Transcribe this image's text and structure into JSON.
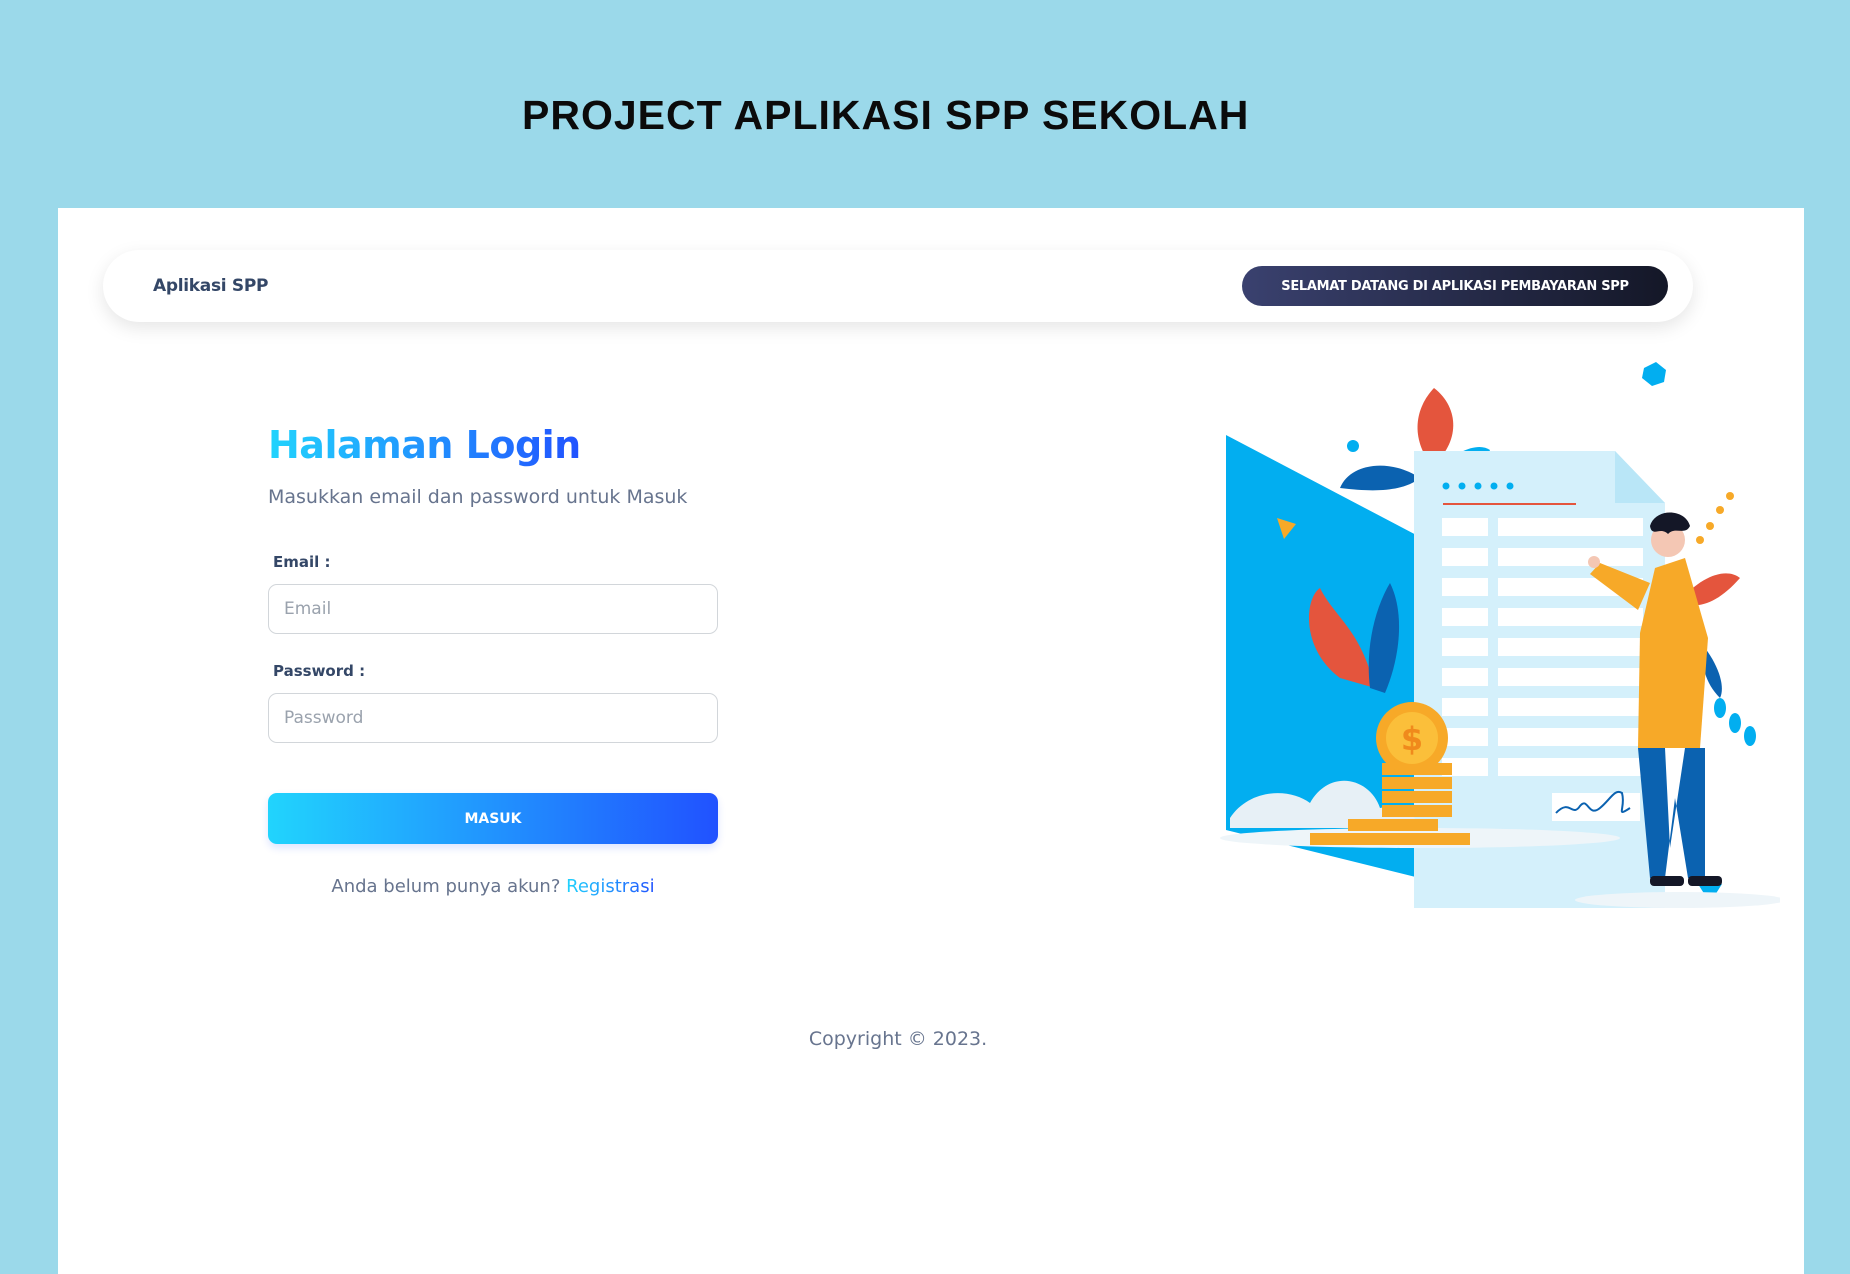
{
  "banner": {
    "title": "PROJECT APLIKASI SPP SEKOLAH"
  },
  "navbar": {
    "brand": "Aplikasi SPP",
    "welcome": "SELAMAT DATANG DI APLIKASI PEMBAYARAN SPP"
  },
  "login": {
    "title": "Halaman Login",
    "subtitle": "Masukkan email dan password untuk Masuk",
    "email_label": "Email :",
    "email_placeholder": "Email",
    "password_label": "Password :",
    "password_placeholder": "Password",
    "submit": "MASUK",
    "register_prompt": "Anda belum punya akun?",
    "register_link": "Registrasi"
  },
  "footer": {
    "copyright": "Copyright © 2023."
  },
  "illustration": {
    "icons": [
      "document-icon",
      "person-icon",
      "coin-icon",
      "leaf-icon"
    ],
    "colors": {
      "blue": "#02aef0",
      "orange": "#f7a928",
      "red": "#e4553d",
      "navy": "#0b62b0"
    }
  },
  "theme": {
    "background": "#9bd9ea",
    "gradient_start": "#21d4fd",
    "gradient_end": "#2152ff",
    "dark_start": "#3a416f",
    "dark_end": "#141727"
  }
}
